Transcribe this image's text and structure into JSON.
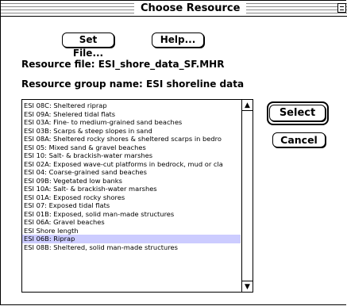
{
  "window": {
    "title": "Choose Resource"
  },
  "buttons": {
    "set_file": "Set File...",
    "help": "Help...",
    "select": "Select",
    "cancel": "Cancel"
  },
  "info": {
    "resource_file_label": "Resource file:",
    "resource_file_value": "ESI_shore_data_SF.MHR",
    "resource_group_label": "Resource group name:",
    "resource_group_value": "ESI shoreline data"
  },
  "list": {
    "selected_index": 23,
    "items": [
      "ESI 08C: Sheltered riprap",
      "ESI 09A: Shelered tidal flats",
      "ESI 03A: Fine- to medium-grained sand beaches",
      "ESI 03B: Scarps & steep slopes in sand",
      "ESI 08A: Sheltered rocky shores & sheltered scarps in bedro",
      "ESI 05: Mixed sand & gravel beaches",
      "ESI 10: Salt- & brackish-water marshes",
      "ESI 02A: Exposed wave-cut platforms in bedrock, mud or cla",
      "ESI 04: Coarse-grained sand beaches",
      "ESI 09B: Vegetated low banks",
      "ESI 10A: Salt- & brackish-water marshes",
      "ESI 01A: Exposed rocky shores",
      "ESI 07: Exposed tidal flats",
      "ESI 01B: Exposed, solid man-made structures",
      "ESI 06A: Gravel beaches",
      "ESI Shore length",
      "ESI 06B: Riprap",
      "ESI 08B: Sheltered, solid man-made structures"
    ]
  }
}
